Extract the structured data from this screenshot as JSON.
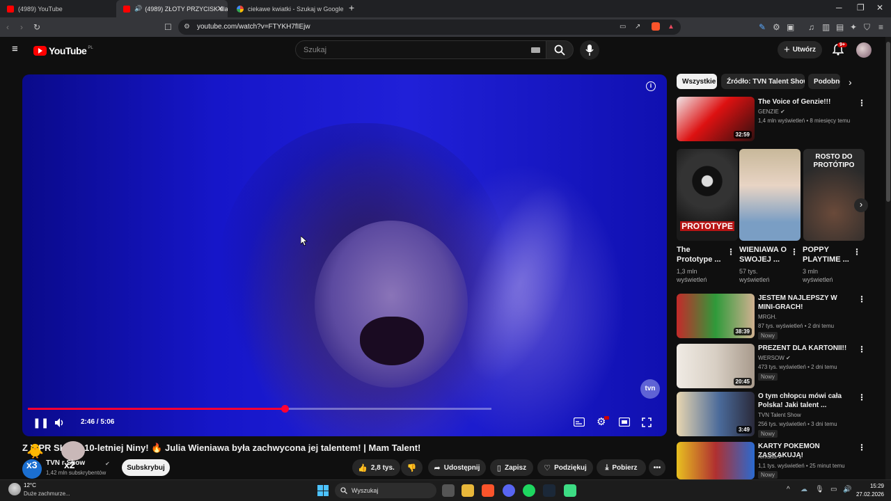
{
  "browser": {
    "tabs": [
      {
        "title": "(4989) YouTube"
      },
      {
        "title": "(4989) ZŁOTY PRZYCISK dla 1("
      },
      {
        "title": "ciekawe kwiatki - Szukaj w Google"
      }
    ],
    "new_tab_symbol": "+",
    "url": "youtube.com/watch?v=FTYKH7fIEjw"
  },
  "youtube": {
    "logo_text": "YouTube",
    "logo_region": "PL",
    "search_placeholder": "Szukaj",
    "create_label": "Utwórz",
    "notif_count": "9+"
  },
  "player": {
    "time": "2:46 / 5:06",
    "progress_fraction": 0.543,
    "buffered_fraction": 0.98,
    "watermark": "tvn"
  },
  "video": {
    "title": "Z Y PR  SK dla 10-letniej Niny! 🔥 Julia Wieniawa była zachwycona jej talentem! | Mam Talent!",
    "channel": "TVN   r Show",
    "subscribers": "1,42 mln subskrybentów",
    "subscribe_label": "Subskrybuj",
    "likes": "2,8 tys.",
    "share_label": "Udostępnij",
    "save_label": "Zapisz",
    "thanks_label": "Podziękuj",
    "download_label": "Pobierz",
    "stickers": [
      "x3",
      "x2"
    ]
  },
  "sidebar": {
    "chips": [
      "Wszystkie",
      "Źródło: TVN Talent Show",
      "Podobne"
    ],
    "first_video": {
      "title": "The Voice of Genzie!!!",
      "channel": "GENZIE",
      "meta": "1,4 mln wyświetleń • 8 miesięcy temu",
      "duration": "32:59"
    },
    "shorts": [
      {
        "title_line1": "The",
        "title_line2": "Prototype ...",
        "views_line1": "1,3 mln",
        "views_line2": "wyświetleń",
        "overlay": "PROTOTYPE"
      },
      {
        "title_line1": "WIENIAWA O",
        "title_line2": "SWOJEJ ...",
        "views_line1": "57 tys.",
        "views_line2": "wyświetleń",
        "overlay": ""
      },
      {
        "title_line1": "POPPY",
        "title_line2": "PLAYTIME ...",
        "views_line1": "3 mln",
        "views_line2": "wyświetleń",
        "overlay": "ROSTO DO PROTÓTIPO"
      }
    ],
    "videos": [
      {
        "title": "JESTEM NAJLEPSZY W MINI-GRACH!",
        "channel": "MRGH.",
        "meta": "87 tys. wyświetleń • 2 dni temu",
        "duration": "38:39",
        "badge": "Nowy"
      },
      {
        "title": "PREZENT DLA KARTONII!!",
        "channel": "WERSOW",
        "meta": "473 tys. wyświetleń • 2 dni temu",
        "duration": "20:45",
        "badge": "Nowy"
      },
      {
        "title": "O tym chłopcu mówi cała Polska! Jaki talent ...",
        "channel": "TVN Talent Show",
        "meta": "256 tys. wyświetleń • 3 dni temu",
        "duration": "3:49",
        "badge": "Nowy"
      },
      {
        "title": "KARTY POKEMON ZASKAKUJĄ!",
        "channel": "remsua",
        "meta": "1,1 tys. wyświetleń • 25 minut temu",
        "duration": "",
        "badge": "Nowy"
      }
    ]
  },
  "taskbar": {
    "weather_temp": "12°C",
    "weather_desc": "Duże zachmurze...",
    "search_label": "Wyszukaj",
    "time": "15:29",
    "date": "27.02.2026"
  },
  "colors": {
    "accent_red": "#ff0033",
    "bg": "#0f0f0f",
    "video_blue": "#1a1ad0"
  }
}
